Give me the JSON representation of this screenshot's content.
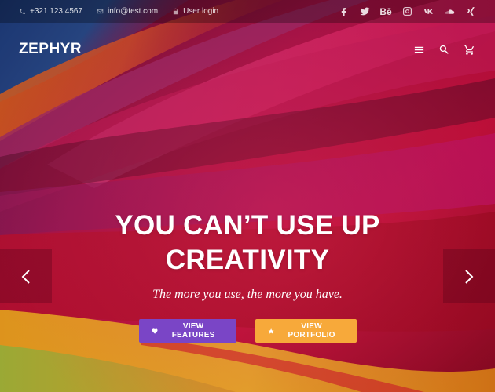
{
  "topbar": {
    "phone": "+321 123 4567",
    "email": "info@test.com",
    "login": "User login",
    "socials": [
      "facebook-icon",
      "twitter-icon",
      "behance-icon",
      "instagram-icon",
      "vk-icon",
      "soundcloud-icon",
      "xing-icon"
    ],
    "behance_label": "Bē"
  },
  "header": {
    "logo": "ZEPHYR",
    "icons": [
      "menu-icon",
      "search-icon",
      "cart-icon"
    ]
  },
  "slide": {
    "title_line1": "YOU CAN’T USE UP",
    "title_line2": "CREATIVITY",
    "subtitle": "The more you use, the more you have.",
    "button_features": "VIEW FEATURES",
    "button_portfolio": "VIEW PORTFOLIO"
  },
  "colors": {
    "features_button": "#7a45c6",
    "portfolio_button": "#f7a93a",
    "topbar_bg": "rgba(0,0,0,0.28)"
  }
}
